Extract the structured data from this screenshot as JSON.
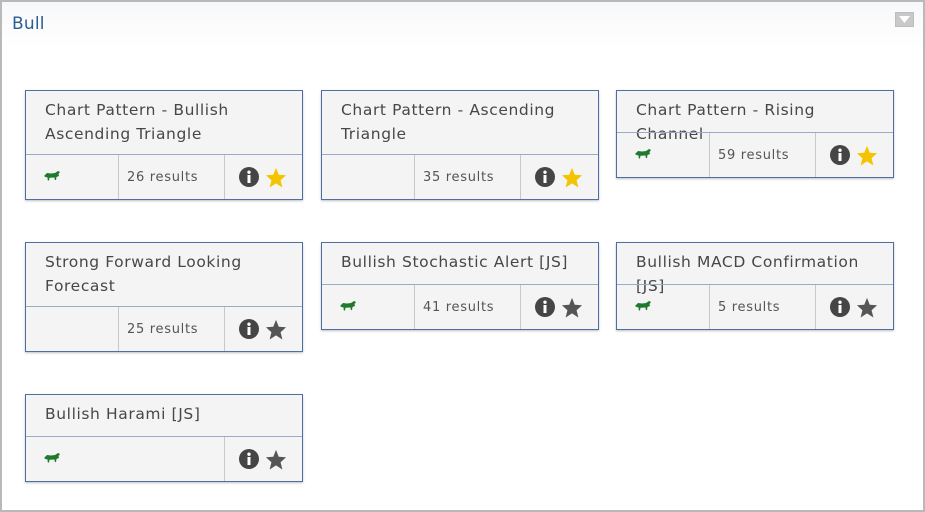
{
  "panel": {
    "title": "Bull"
  },
  "colors": {
    "accent": "#2a5d94",
    "star_active": "#f5c400",
    "star_inactive": "#555555",
    "bull": "#1f7a2e",
    "card_border": "#4f6fa3"
  },
  "icons": {
    "bull": "bull-icon",
    "info": "info-icon",
    "star": "star-icon",
    "collapse": "collapse-arrow-icon"
  },
  "cards": [
    {
      "title": "Chart Pattern - Bullish Ascending Triangle",
      "results": "26 results",
      "has_bull": true,
      "starred": true
    },
    {
      "title": "Chart Pattern - Ascending Triangle",
      "results": "35 results",
      "has_bull": false,
      "starred": true
    },
    {
      "title": "Chart Pattern - Rising Channel",
      "results": "59 results",
      "has_bull": true,
      "starred": true
    },
    {
      "title": "Strong Forward Looking Forecast",
      "results": "25 results",
      "has_bull": false,
      "starred": false
    },
    {
      "title": "Bullish Stochastic Alert [JS]",
      "results": "41 results",
      "has_bull": true,
      "starred": false
    },
    {
      "title": "Bullish MACD Confirmation [JS]",
      "results": "5 results",
      "has_bull": true,
      "starred": false
    },
    {
      "title": "Bullish Harami [JS]",
      "results": "",
      "has_bull": true,
      "starred": false
    }
  ]
}
